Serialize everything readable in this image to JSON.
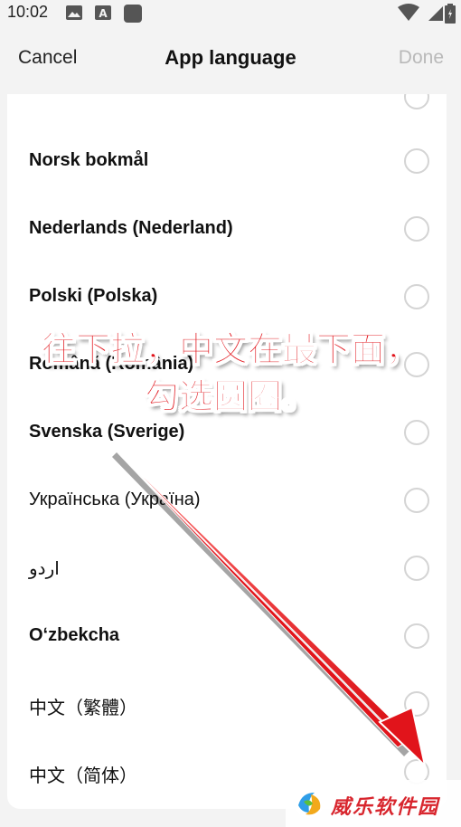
{
  "status_bar": {
    "time": "10:02",
    "icons": [
      "image-icon",
      "text-a-icon",
      "app-square-icon",
      "wifi-icon",
      "battery-icon"
    ]
  },
  "header": {
    "cancel_label": "Cancel",
    "title": "App language",
    "done_label": "Done"
  },
  "languages": [
    {
      "label": "Norsk bokmål",
      "selected": false
    },
    {
      "label": "Nederlands (Nederland)",
      "selected": false
    },
    {
      "label": "Polski (Polska)",
      "selected": false
    },
    {
      "label": "Română (România)",
      "selected": false
    },
    {
      "label": "Svenska (Sverige)",
      "selected": false
    },
    {
      "label": "Українська (Україна)",
      "selected": false
    },
    {
      "label": "اردو",
      "selected": false
    },
    {
      "label": "Oʻzbekcha",
      "selected": false
    },
    {
      "label": "中文（繁體）",
      "selected": false
    },
    {
      "label": "中文（简体）",
      "selected": false
    }
  ],
  "annotation": {
    "line1": "往下拉，中文在最下面，",
    "line2": "勾选圆圈。",
    "color": "#e1141b"
  },
  "watermark": {
    "text": "威乐软件园"
  },
  "colors": {
    "background": "#f3f3f3",
    "card": "#ffffff",
    "done_disabled": "#b9b9b9",
    "radio_border": "#d4d4d4",
    "annotation_red": "#e1141b"
  }
}
